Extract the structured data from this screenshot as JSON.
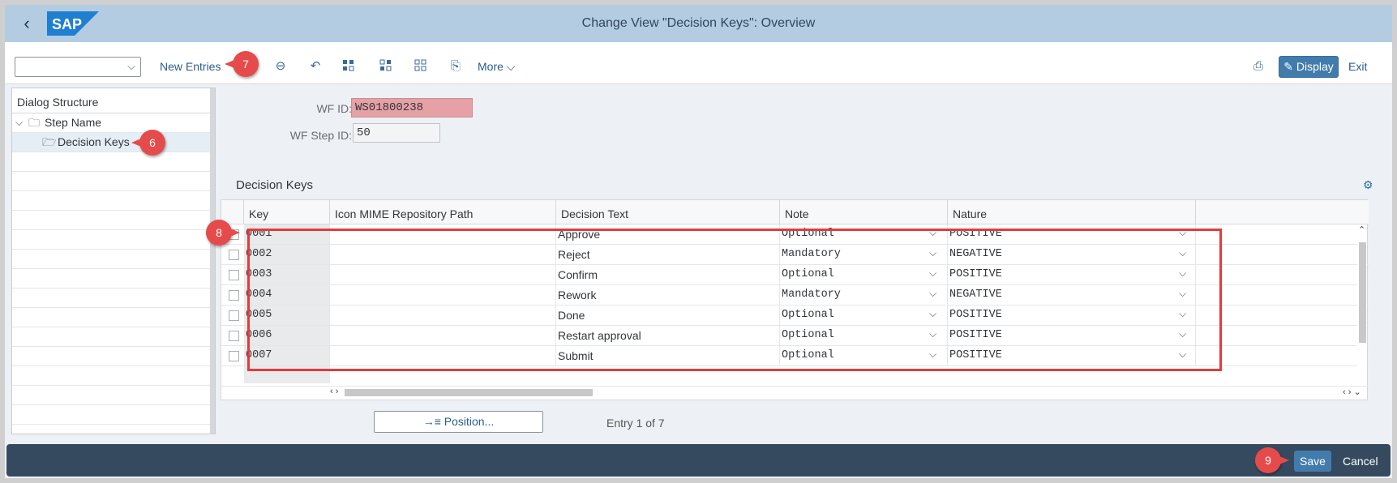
{
  "header": {
    "back_icon": "back-chevron-icon",
    "logo_text": "SAP",
    "title": "Change View \"Decision Keys\": Overview"
  },
  "toolbar": {
    "select_value": "",
    "new_entries": "New Entries",
    "icons": [
      "remove-icon",
      "undo-icon",
      "select-all-icon",
      "select-block-icon",
      "deselect-all-icon",
      "transport-icon"
    ],
    "more": "More",
    "print_icon": "print-icon",
    "display": "Display",
    "exit": "Exit"
  },
  "dialog_structure": {
    "title": "Dialog Structure",
    "items": [
      {
        "label": "Step Name",
        "icon": "folder-icon"
      },
      {
        "label": "Decision Keys",
        "icon": "folder-open-icon"
      }
    ]
  },
  "form": {
    "wf_id_label": "WF ID:",
    "wf_id_value": "WS01800238",
    "wf_step_label": "WF Step ID:",
    "wf_step_value": "50"
  },
  "table": {
    "title": "Decision Keys",
    "columns": [
      "Key",
      "Icon MIME Repository Path",
      "Decision Text",
      "Note",
      "Nature"
    ],
    "rows": [
      {
        "key": "0001",
        "path": "",
        "text": "Approve",
        "note": "Optional",
        "nature": "POSITIVE"
      },
      {
        "key": "0002",
        "path": "",
        "text": "Reject",
        "note": "Mandatory",
        "nature": "NEGATIVE"
      },
      {
        "key": "0003",
        "path": "",
        "text": "Confirm",
        "note": "Optional",
        "nature": "POSITIVE"
      },
      {
        "key": "0004",
        "path": "",
        "text": "Rework",
        "note": "Mandatory",
        "nature": "NEGATIVE"
      },
      {
        "key": "0005",
        "path": "",
        "text": "Done",
        "note": "Optional",
        "nature": "POSITIVE"
      },
      {
        "key": "0006",
        "path": "",
        "text": "Restart approval",
        "note": "Optional",
        "nature": "POSITIVE"
      },
      {
        "key": "0007",
        "path": "",
        "text": "Submit",
        "note": "Optional",
        "nature": "POSITIVE"
      }
    ]
  },
  "position_button": "→≡ Position...",
  "entry_info": "Entry 1 of 7",
  "footer": {
    "save": "Save",
    "cancel": "Cancel"
  },
  "callouts": {
    "c6": "6",
    "c7": "7",
    "c8": "8",
    "c9": "9"
  },
  "colors": {
    "accent": "#427cac",
    "header": "#b4cce2",
    "footer": "#354a5f",
    "callout": "#e64b4b",
    "error_field": "#e5a1a6"
  }
}
